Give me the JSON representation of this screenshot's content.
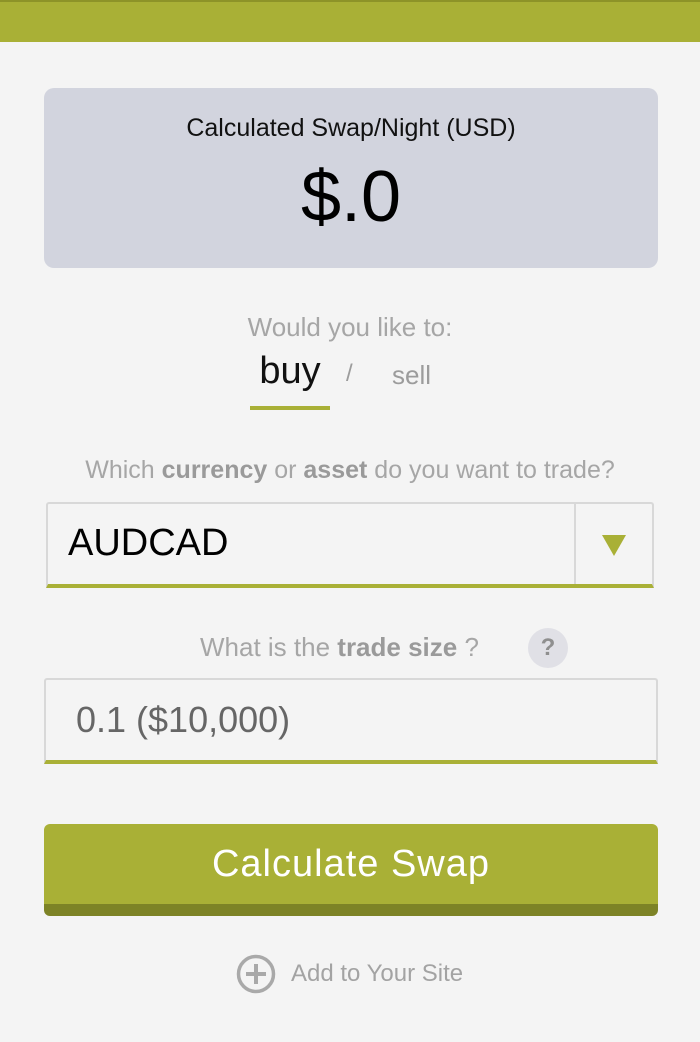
{
  "result": {
    "label": "Calculated Swap/Night (USD)",
    "value": "$.0"
  },
  "direction": {
    "prompt": "Would you like to:",
    "buy_label": "buy",
    "separator": "/",
    "sell_label": "sell",
    "selected": "buy"
  },
  "asset": {
    "prompt_pre": "Which ",
    "prompt_bold1": "currency",
    "prompt_mid": " or ",
    "prompt_bold2": "asset",
    "prompt_post": " do you want to trade?",
    "selected_value": "AUDCAD"
  },
  "trade_size": {
    "prompt_pre": "What is the ",
    "prompt_bold": "trade size",
    "prompt_post": " ?",
    "help_label": "?",
    "value": "0.1 ($10,000)"
  },
  "calculate_button": {
    "label": "Calculate Swap"
  },
  "footer": {
    "add_label": "Add to Your Site"
  },
  "colors": {
    "accent": "#a9b036",
    "accent_dark": "#7d8326",
    "panel_bg": "#d2d4de",
    "page_bg": "#f4f4f4"
  }
}
